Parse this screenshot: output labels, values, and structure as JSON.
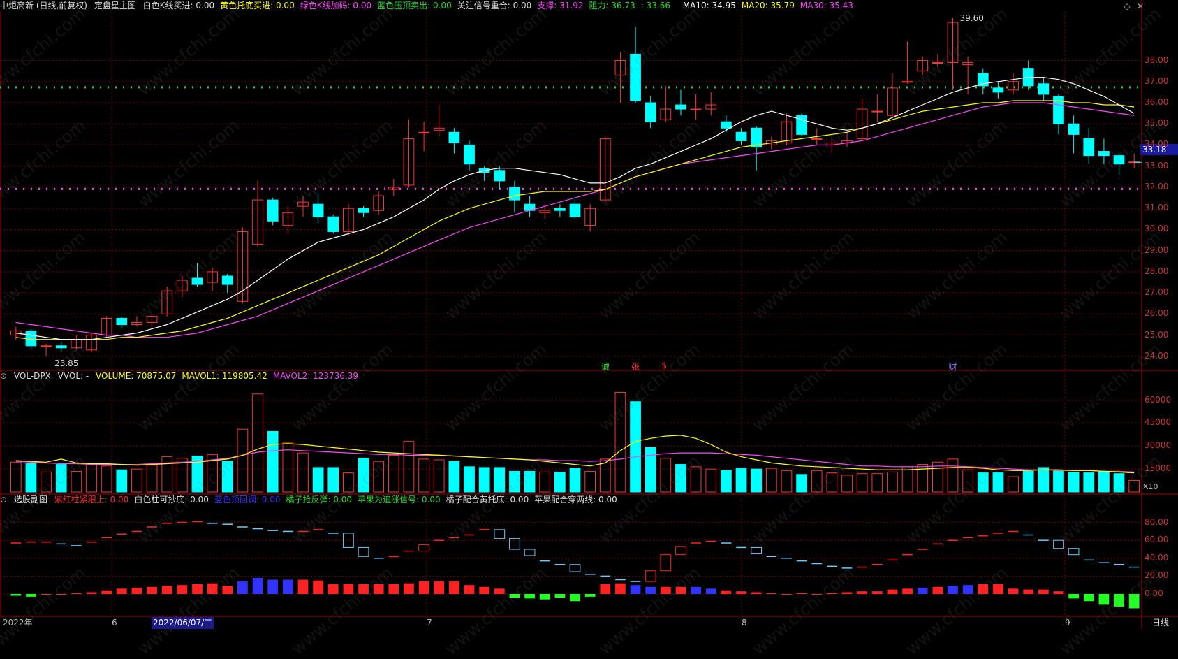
{
  "main_panel": {
    "stock_name": "中炬高新 (日线,前复权)",
    "indicator_name": "定盘星主图",
    "params": [
      {
        "label": "白色K线买进:",
        "value": "0.00",
        "color": "#dddddd"
      },
      {
        "label": "黄色托底买进:",
        "value": "0.00",
        "color": "#ffff00"
      },
      {
        "label": "绿色K线加码:",
        "value": "0.00",
        "color": "#ff44ff"
      },
      {
        "label": "蓝色压顶卖出:",
        "value": "0.00",
        "color": "#22dd22"
      },
      {
        "label": "关注信号重合:",
        "value": "0.00",
        "color": "#dddddd"
      },
      {
        "label": "支撑:",
        "value": "31.92",
        "color": "#ff44ff"
      },
      {
        "label": "阻力:",
        "value": "36.73",
        "color": "#22dd22"
      },
      {
        "label": ":",
        "value": "33.66",
        "color": "#22dd22"
      }
    ],
    "ma": [
      {
        "label": "MA10:",
        "value": "34.95",
        "color": "#ffffff"
      },
      {
        "label": "MA20:",
        "value": "35.79",
        "color": "#ffff00"
      },
      {
        "label": "MA30:",
        "value": "35.43",
        "color": "#ff44ff"
      }
    ],
    "high_label": "39.60",
    "low_label": "23.85",
    "last_price": "33.18",
    "y_ticks": [
      "38.00",
      "37.00",
      "36.00",
      "35.00",
      "34.00",
      "33.00",
      "32.00",
      "31.00",
      "30.00",
      "29.00",
      "28.00",
      "27.00",
      "26.00",
      "25.00",
      "24.00"
    ],
    "events": [
      {
        "text": "诚",
        "color": "#22dd22"
      },
      {
        "text": "张",
        "color": "#ff3333"
      },
      {
        "text": "$",
        "color": "#ff3333"
      },
      {
        "text": "财",
        "color": "#8888ff"
      }
    ]
  },
  "volume_panel": {
    "title": "VOL-DPX",
    "vvol": "VVOL: -",
    "items": [
      {
        "label": "VOLUME:",
        "value": "70875.07",
        "color": "#ffff00"
      },
      {
        "label": "MAVOL1:",
        "value": "119805.42",
        "color": "#ffff00"
      },
      {
        "label": "MAVOL2:",
        "value": "123736.39",
        "color": "#ff44ff"
      }
    ],
    "y_ticks": [
      "60000",
      "45000",
      "30000",
      "15000"
    ],
    "multiplier": "X10"
  },
  "sub_panel": {
    "title": "选股副图",
    "items": [
      {
        "label": "紫红柱紧跟上:",
        "value": "0.00",
        "color": "#ff3333"
      },
      {
        "label": "白色柱可抄底:",
        "value": "0.00",
        "color": "#dddddd"
      },
      {
        "label": "蓝色顶回调:",
        "value": "0.00",
        "color": "#3333ff"
      },
      {
        "label": "橘子抢反弹:",
        "value": "0.00",
        "color": "#22dd22"
      },
      {
        "label": "苹果为追涨信号:",
        "value": "0.00",
        "color": "#22dd22"
      },
      {
        "label": "橘子配合黄托底:",
        "value": "0.00",
        "color": "#dddddd"
      },
      {
        "label": "苹果配合穿两线:",
        "value": "0.00",
        "color": "#dddddd"
      }
    ],
    "y_ticks": [
      "80.00",
      "60.00",
      "40.00",
      "20.00",
      "0.00"
    ]
  },
  "bottom_bar": {
    "year": "2022年",
    "m6": "6",
    "cursor_date": "2022/06/07/二",
    "m7": "7",
    "m8": "8",
    "m9": "9",
    "period": "日线"
  },
  "watermark": "www.cfchi.com",
  "colors": {
    "up": "#ff3333",
    "down": "#00ffff",
    "ma10": "#ffffff",
    "ma20": "#ffff00",
    "ma30": "#ff44ff",
    "grid": "#7a0000"
  },
  "chart_data": {
    "type": "candlestick",
    "ylim": [
      23.5,
      40.2
    ],
    "support": 31.92,
    "resistance": 36.73,
    "candles": [
      [
        25.0,
        25.2,
        25.4,
        24.8
      ],
      [
        25.2,
        24.5,
        25.3,
        24.3
      ],
      [
        24.5,
        24.5,
        24.6,
        24.0
      ],
      [
        24.5,
        24.4,
        24.7,
        24.2
      ],
      [
        24.4,
        24.8,
        25.0,
        24.3
      ],
      [
        24.3,
        25.0,
        25.1,
        24.2
      ],
      [
        25.0,
        25.8,
        25.9,
        24.9
      ],
      [
        25.8,
        25.5,
        25.9,
        25.3
      ],
      [
        25.5,
        25.6,
        25.9,
        25.4
      ],
      [
        25.6,
        25.9,
        26.0,
        25.4
      ],
      [
        26.0,
        27.1,
        27.3,
        25.9
      ],
      [
        27.1,
        27.6,
        27.8,
        26.8
      ],
      [
        27.7,
        27.4,
        28.4,
        27.3
      ],
      [
        27.5,
        28.0,
        28.2,
        27.1
      ],
      [
        27.8,
        27.4,
        27.9,
        27.0
      ],
      [
        26.6,
        29.9,
        30.1,
        26.5
      ],
      [
        29.3,
        31.4,
        32.3,
        29.2
      ],
      [
        31.4,
        30.4,
        31.5,
        30.2
      ],
      [
        30.2,
        30.8,
        31.1,
        29.8
      ],
      [
        31.1,
        31.3,
        31.6,
        30.6
      ],
      [
        31.2,
        30.6,
        31.7,
        30.3
      ],
      [
        30.6,
        29.9,
        30.7,
        29.8
      ],
      [
        29.9,
        31.0,
        31.2,
        29.7
      ],
      [
        31.0,
        30.8,
        31.1,
        30.6
      ],
      [
        30.9,
        31.6,
        31.8,
        30.7
      ],
      [
        31.9,
        32.0,
        32.4,
        31.6
      ],
      [
        32.1,
        34.3,
        35.2,
        32.0
      ],
      [
        34.6,
        34.6,
        35.1,
        33.7
      ],
      [
        34.7,
        34.8,
        35.9,
        34.4
      ],
      [
        34.6,
        34.1,
        34.8,
        33.6
      ],
      [
        34.0,
        33.1,
        34.2,
        32.8
      ],
      [
        32.9,
        32.7,
        33.0,
        32.3
      ],
      [
        32.8,
        32.3,
        33.0,
        31.9
      ],
      [
        32.0,
        31.4,
        32.3,
        30.8
      ],
      [
        31.2,
        30.9,
        31.6,
        30.6
      ],
      [
        30.8,
        30.9,
        31.2,
        30.5
      ],
      [
        31.0,
        30.9,
        31.2,
        30.6
      ],
      [
        31.2,
        30.6,
        31.6,
        30.5
      ],
      [
        30.2,
        31.0,
        31.2,
        29.9
      ],
      [
        31.4,
        34.3,
        34.4,
        31.3
      ],
      [
        37.3,
        38.0,
        38.4,
        36.0
      ],
      [
        38.3,
        36.1,
        39.6,
        36.0
      ],
      [
        36.0,
        35.1,
        36.3,
        34.8
      ],
      [
        35.2,
        35.7,
        36.8,
        35.1
      ],
      [
        35.9,
        35.7,
        36.6,
        35.4
      ],
      [
        35.7,
        35.7,
        36.4,
        35.2
      ],
      [
        35.7,
        35.9,
        36.5,
        35.4
      ],
      [
        35.1,
        34.8,
        35.4,
        34.6
      ],
      [
        34.6,
        34.2,
        34.8,
        34.0
      ],
      [
        34.8,
        33.9,
        34.9,
        32.8
      ],
      [
        34.0,
        34.2,
        34.4,
        33.8
      ],
      [
        34.1,
        35.1,
        35.5,
        34.0
      ],
      [
        35.4,
        34.5,
        35.5,
        34.4
      ],
      [
        34.3,
        34.3,
        34.8,
        34.0
      ],
      [
        34.0,
        34.1,
        34.3,
        33.6
      ],
      [
        34.1,
        34.2,
        34.6,
        33.9
      ],
      [
        34.3,
        35.7,
        36.2,
        34.2
      ],
      [
        35.6,
        35.6,
        36.4,
        35.1
      ],
      [
        35.4,
        36.7,
        37.4,
        35.3
      ],
      [
        37.0,
        37.0,
        38.9,
        36.9
      ],
      [
        37.5,
        38.0,
        38.2,
        37.3
      ],
      [
        37.9,
        37.9,
        38.3,
        37.7
      ],
      [
        37.9,
        39.8,
        40.0,
        36.6
      ],
      [
        37.8,
        37.9,
        38.2,
        36.4
      ],
      [
        37.4,
        36.8,
        37.6,
        36.4
      ],
      [
        36.7,
        36.5,
        37.0,
        36.2
      ],
      [
        36.6,
        37.0,
        37.4,
        36.4
      ],
      [
        37.6,
        36.8,
        38.0,
        36.6
      ],
      [
        36.9,
        36.4,
        37.2,
        36.1
      ],
      [
        36.3,
        35.0,
        36.4,
        34.5
      ],
      [
        35.0,
        34.5,
        35.4,
        33.6
      ],
      [
        34.3,
        33.5,
        34.8,
        33.1
      ],
      [
        33.7,
        33.5,
        34.3,
        33.1
      ],
      [
        33.5,
        33.1,
        33.6,
        32.6
      ],
      [
        33.2,
        33.2,
        33.6,
        32.9
      ]
    ],
    "ma10": [
      25.1,
      25.0,
      24.9,
      24.8,
      24.8,
      24.8,
      24.9,
      25.0,
      25.1,
      25.3,
      25.5,
      25.8,
      26.1,
      26.4,
      26.7,
      27.1,
      27.6,
      28.1,
      28.6,
      29.0,
      29.4,
      29.6,
      29.8,
      30.0,
      30.3,
      30.6,
      31.0,
      31.4,
      31.9,
      32.3,
      32.6,
      32.8,
      32.9,
      32.9,
      32.8,
      32.7,
      32.6,
      32.4,
      32.2,
      32.2,
      32.5,
      32.9,
      33.1,
      33.4,
      33.7,
      34.0,
      34.3,
      34.7,
      35.1,
      35.4,
      35.6,
      35.4,
      35.2,
      35.0,
      34.8,
      34.7,
      34.8,
      35.0,
      35.3,
      35.6,
      35.9,
      36.2,
      36.5,
      36.7,
      36.9,
      37.0,
      37.1,
      37.2,
      37.2,
      37.1,
      36.9,
      36.6,
      36.3,
      35.9,
      35.5
    ],
    "ma20": [
      24.9,
      24.8,
      24.8,
      24.8,
      24.8,
      24.8,
      24.8,
      24.9,
      24.9,
      25.0,
      25.1,
      25.2,
      25.4,
      25.6,
      25.8,
      26.1,
      26.4,
      26.7,
      27.0,
      27.3,
      27.6,
      27.9,
      28.2,
      28.5,
      28.8,
      29.2,
      29.6,
      30.0,
      30.4,
      30.7,
      31.0,
      31.2,
      31.4,
      31.6,
      31.7,
      31.8,
      31.8,
      31.8,
      31.8,
      31.9,
      32.2,
      32.5,
      32.7,
      32.9,
      33.1,
      33.3,
      33.5,
      33.7,
      33.9,
      34.0,
      34.1,
      34.2,
      34.3,
      34.4,
      34.5,
      34.6,
      34.8,
      35.0,
      35.2,
      35.4,
      35.6,
      35.7,
      35.8,
      35.9,
      36.0,
      36.0,
      36.1,
      36.1,
      36.1,
      36.1,
      36.0,
      36.0,
      35.9,
      35.9,
      35.8
    ],
    "ma30": [
      25.6,
      25.5,
      25.4,
      25.3,
      25.2,
      25.1,
      25.0,
      25.0,
      24.9,
      24.9,
      24.9,
      25.0,
      25.1,
      25.3,
      25.5,
      25.7,
      25.9,
      26.2,
      26.5,
      26.8,
      27.1,
      27.4,
      27.7,
      28.0,
      28.3,
      28.6,
      28.9,
      29.2,
      29.5,
      29.8,
      30.1,
      30.3,
      30.5,
      30.7,
      30.9,
      31.1,
      31.3,
      31.5,
      31.7,
      31.9,
      32.2,
      32.5,
      32.7,
      32.9,
      33.1,
      33.2,
      33.3,
      33.4,
      33.5,
      33.6,
      33.7,
      33.8,
      33.9,
      34.0,
      34.0,
      34.1,
      34.2,
      34.4,
      34.6,
      34.8,
      35.0,
      35.2,
      35.4,
      35.6,
      35.8,
      35.9,
      36.0,
      36.0,
      36.0,
      35.9,
      35.8,
      35.7,
      35.6,
      35.5,
      35.4
    ],
    "volume": [
      1950,
      1850,
      1300,
      1800,
      1350,
      1800,
      1700,
      1450,
      1500,
      1750,
      2300,
      2200,
      2350,
      2450,
      2000,
      4100,
      6400,
      3950,
      3200,
      2550,
      1600,
      1600,
      1250,
      2200,
      2000,
      2400,
      3300,
      2150,
      2100,
      2000,
      1650,
      1600,
      1600,
      1350,
      1350,
      1300,
      1300,
      1550,
      1350,
      2150,
      6500,
      5900,
      2900,
      2200,
      1800,
      1650,
      1500,
      1400,
      1550,
      1500,
      1550,
      1400,
      1150,
      1400,
      1250,
      1100,
      1200,
      1200,
      1300,
      1650,
      1800,
      1950,
      2150,
      1450,
      1250,
      1250,
      1000,
      1350,
      1600,
      1400,
      1300,
      1250,
      1350,
      1200,
      750
    ],
    "mavol1": [
      2050,
      2000,
      1950,
      2150,
      1900,
      1850,
      1850,
      1800,
      1750,
      1800,
      1850,
      1900,
      1950,
      2050,
      2150,
      2400,
      2800,
      3100,
      3150,
      3100,
      3000,
      2900,
      2800,
      2700,
      2600,
      2550,
      2500,
      2450,
      2400,
      2350,
      2300,
      2250,
      2200,
      2150,
      2100,
      2000,
      1900,
      1800,
      1700,
      1900,
      2700,
      3300,
      3500,
      3650,
      3700,
      3500,
      3100,
      2600,
      2300,
      2100,
      1900,
      1800,
      1700,
      1650,
      1600,
      1550,
      1500,
      1450,
      1450,
      1450,
      1500,
      1550,
      1600,
      1600,
      1550,
      1450,
      1400,
      1400,
      1450,
      1450,
      1400,
      1400,
      1350,
      1300,
      1250
    ],
    "mavol2": [
      2000,
      1950,
      1900,
      1850,
      1850,
      1800,
      1800,
      1800,
      1800,
      1850,
      1900,
      1950,
      2000,
      2100,
      2200,
      2400,
      2600,
      2700,
      2750,
      2700,
      2650,
      2600,
      2550,
      2500,
      2450,
      2450,
      2400,
      2400,
      2400,
      2350,
      2300,
      2250,
      2200,
      2150,
      2100,
      2100,
      2050,
      2050,
      2000,
      2050,
      2150,
      2300,
      2400,
      2500,
      2550,
      2550,
      2550,
      2500,
      2450,
      2400,
      2300,
      2200,
      2100,
      2000,
      1900,
      1800,
      1700,
      1700,
      1650,
      1650,
      1650,
      1700,
      1700,
      1650,
      1600,
      1550,
      1500,
      1450,
      1450,
      1400,
      1400,
      1400,
      1350,
      1350,
      1300
    ],
    "sub_line": [
      57,
      58,
      58,
      56,
      54,
      58,
      63,
      67,
      70,
      75,
      79,
      80,
      81,
      79,
      78,
      75,
      73,
      71,
      70,
      70,
      72,
      68,
      52,
      42,
      40,
      42,
      48,
      55,
      60,
      63,
      66,
      72,
      62,
      50,
      43,
      37,
      33,
      25,
      22,
      20,
      16,
      14,
      26,
      44,
      53,
      57,
      59,
      57,
      52,
      45,
      42,
      40,
      37,
      34,
      31,
      29,
      30,
      33,
      38,
      44,
      50,
      56,
      60,
      63,
      65,
      68,
      70,
      66,
      60,
      51,
      44,
      38,
      35,
      33,
      30
    ],
    "sub_bars": [
      -2,
      -3,
      0,
      0,
      1,
      2,
      4,
      6,
      7,
      8,
      9,
      10,
      11,
      12,
      9,
      14,
      18,
      16,
      16,
      16,
      15,
      11,
      11,
      11,
      11,
      11,
      12,
      14,
      14,
      14,
      10,
      8,
      6,
      -4,
      -5,
      -6,
      -4,
      -8,
      -3,
      11,
      12,
      10,
      8,
      8,
      8,
      8,
      6,
      4,
      3,
      2,
      1,
      0,
      1,
      0,
      1,
      2,
      3,
      3,
      5,
      6,
      7,
      8,
      9,
      10,
      11,
      11,
      6,
      5,
      5,
      3,
      -5,
      -8,
      -12,
      -14,
      -16
    ]
  }
}
